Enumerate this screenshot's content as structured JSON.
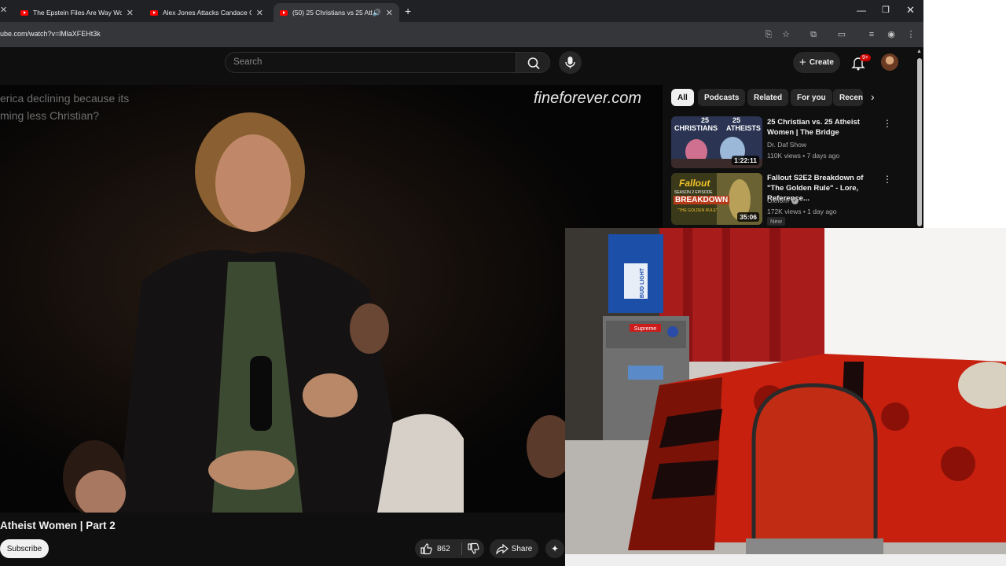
{
  "browser": {
    "tabs": [
      {
        "title": "The Epstein Files Are Way Wors",
        "active": false
      },
      {
        "title": "Alex Jones Attacks Candace Ow",
        "active": false
      },
      {
        "title": "(50) 25 Christians vs 25 Ath",
        "active": true
      }
    ],
    "url": "ube.com/watch?v=lMlaXFEHt3k"
  },
  "header": {
    "search_placeholder": "Search",
    "create_label": "Create",
    "notification_count": "9+"
  },
  "video": {
    "watermark": "fineforever.com",
    "caption_line1": "erica declining because its",
    "caption_line2": "ming less Christian?",
    "title": "Atheist Women | Part 2",
    "subscribe_label": "Subscribe",
    "like_count": "862",
    "share_label": "Share"
  },
  "chips": [
    "All",
    "Podcasts",
    "Related",
    "For you",
    "Recen"
  ],
  "recommendations": [
    {
      "title": "25 Christian vs. 25 Atheist Women | The Bridge",
      "channel": "Dr. Daf Show",
      "meta": "110K views • 7 days ago",
      "duration": "1:22:11",
      "thumb_text_left": "CHRISTIANS",
      "thumb_text_right": "ATHEISTS",
      "thumb_num": "25"
    },
    {
      "title": "Fallout S2E2 Breakdown of \"The Golden Rule\" - Lore, Reference...",
      "channel": "Oxhorn",
      "meta": "172K views • 1 day ago",
      "duration": "35:06",
      "badge": "New",
      "thumb_text_top": "Fallout",
      "thumb_text_sub": "SEASON 2 EPISODE",
      "thumb_text_main": "BREAKDOWN",
      "thumb_text_bottom": "\"THE GOLDEN RULE\""
    }
  ],
  "webcam": {
    "box_label": "BUD LIGHT",
    "fridge_sticker": "Supreme"
  }
}
